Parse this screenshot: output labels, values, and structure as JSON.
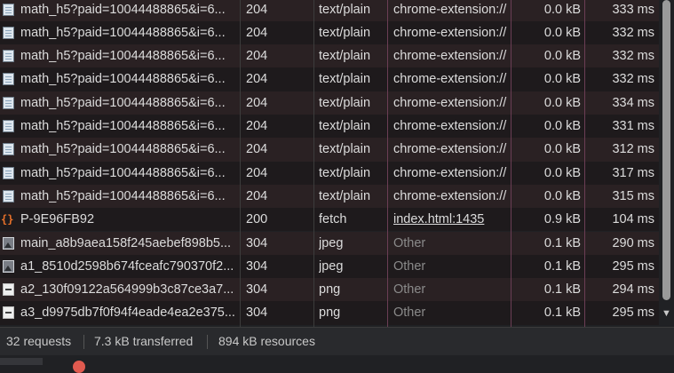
{
  "rows": [
    {
      "icon": "document-icon",
      "name": "math_h5?paid=10044488865&i=6...",
      "status": "204",
      "type": "text/plain",
      "initiator": "chrome-extension://",
      "initiator_style": "plain",
      "size": "0.0 kB",
      "time": "333 ms"
    },
    {
      "icon": "document-icon",
      "name": "math_h5?paid=10044488865&i=6...",
      "status": "204",
      "type": "text/plain",
      "initiator": "chrome-extension://",
      "initiator_style": "plain",
      "size": "0.0 kB",
      "time": "332 ms"
    },
    {
      "icon": "document-icon",
      "name": "math_h5?paid=10044488865&i=6...",
      "status": "204",
      "type": "text/plain",
      "initiator": "chrome-extension://",
      "initiator_style": "plain",
      "size": "0.0 kB",
      "time": "332 ms"
    },
    {
      "icon": "document-icon",
      "name": "math_h5?paid=10044488865&i=6...",
      "status": "204",
      "type": "text/plain",
      "initiator": "chrome-extension://",
      "initiator_style": "plain",
      "size": "0.0 kB",
      "time": "332 ms"
    },
    {
      "icon": "document-icon",
      "name": "math_h5?paid=10044488865&i=6...",
      "status": "204",
      "type": "text/plain",
      "initiator": "chrome-extension://",
      "initiator_style": "plain",
      "size": "0.0 kB",
      "time": "334 ms"
    },
    {
      "icon": "document-icon",
      "name": "math_h5?paid=10044488865&i=6...",
      "status": "204",
      "type": "text/plain",
      "initiator": "chrome-extension://",
      "initiator_style": "plain",
      "size": "0.0 kB",
      "time": "331 ms"
    },
    {
      "icon": "document-icon",
      "name": "math_h5?paid=10044488865&i=6...",
      "status": "204",
      "type": "text/plain",
      "initiator": "chrome-extension://",
      "initiator_style": "plain",
      "size": "0.0 kB",
      "time": "312 ms"
    },
    {
      "icon": "document-icon",
      "name": "math_h5?paid=10044488865&i=6...",
      "status": "204",
      "type": "text/plain",
      "initiator": "chrome-extension://",
      "initiator_style": "plain",
      "size": "0.0 kB",
      "time": "317 ms"
    },
    {
      "icon": "document-icon",
      "name": "math_h5?paid=10044488865&i=6...",
      "status": "204",
      "type": "text/plain",
      "initiator": "chrome-extension://",
      "initiator_style": "plain",
      "size": "0.0 kB",
      "time": "315 ms"
    },
    {
      "icon": "fetch-icon",
      "name": "P-9E96FB92",
      "status": "200",
      "type": "fetch",
      "initiator": "index.html:1435",
      "initiator_style": "link",
      "size": "0.9 kB",
      "time": "104 ms"
    },
    {
      "icon": "image-icon",
      "name": "main_a8b9aea158f245aebef898b5...",
      "status": "304",
      "type": "jpeg",
      "initiator": "Other",
      "initiator_style": "muted",
      "size": "0.1 kB",
      "time": "290 ms"
    },
    {
      "icon": "image-icon",
      "name": "a1_8510d2598b674fceafc790370f2...",
      "status": "304",
      "type": "jpeg",
      "initiator": "Other",
      "initiator_style": "muted",
      "size": "0.1 kB",
      "time": "295 ms"
    },
    {
      "icon": "png-image-icon",
      "name": "a2_130f09122a564999b3c87ce3a7...",
      "status": "304",
      "type": "png",
      "initiator": "Other",
      "initiator_style": "muted",
      "size": "0.1 kB",
      "time": "294 ms"
    },
    {
      "icon": "png-image-icon",
      "name": "a3_d9975db7f0f94f4eade4ea2e375...",
      "status": "304",
      "type": "png",
      "initiator": "Other",
      "initiator_style": "muted",
      "size": "0.1 kB",
      "time": "295 ms"
    }
  ],
  "summary": {
    "requests": "32 requests",
    "transferred": "7.3 kB transferred",
    "resources": "894 kB resources"
  },
  "colors": {
    "background": "#202124",
    "row_odd": "#2a2123",
    "row_even": "#1e1a1c",
    "fetch_icon": "#e8712a",
    "column_divider_accent": "#6b3e55"
  },
  "fetch_icon_glyph": "{}",
  "scrollbar_arrow_glyph": "▼"
}
